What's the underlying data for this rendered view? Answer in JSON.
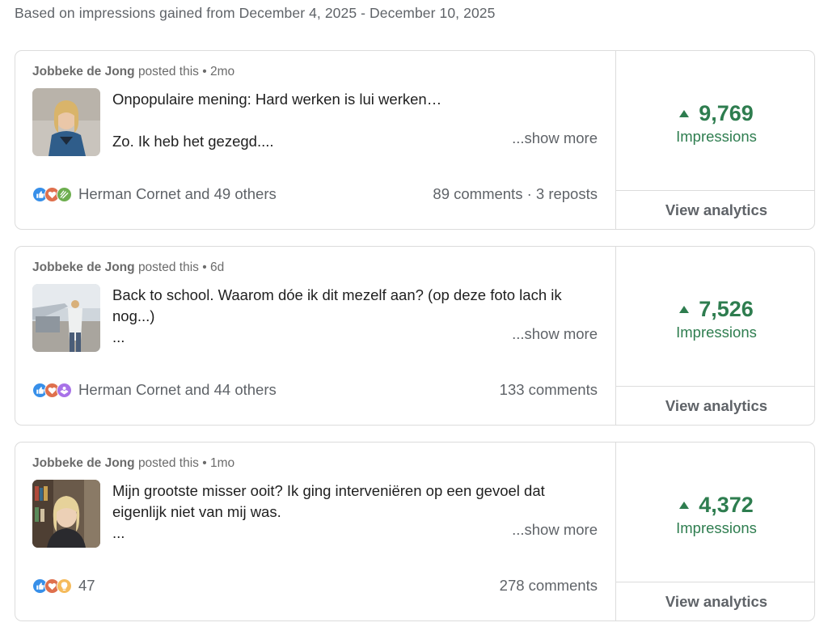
{
  "header": {
    "text": "Based on impressions gained from December 4, 2025 - December 10, 2025"
  },
  "posts": [
    {
      "author": "Jobbeke de Jong",
      "posted_label": "posted this",
      "age": "2mo",
      "text": "Onpopulaire mening: Hard werken is lui werken…\n\nZo. Ik heb het gezegd....",
      "show_more": "...show more",
      "reaction_icons": [
        "like-icon",
        "love-icon",
        "celebrate-icon"
      ],
      "reactors": "Herman Cornet and 49 others",
      "engagement": "89 comments · 3 reposts",
      "impressions_value": "9,769",
      "impressions_label": "Impressions",
      "view_analytics": "View analytics"
    },
    {
      "author": "Jobbeke de Jong",
      "posted_label": "posted this",
      "age": "6d",
      "text": "Back to school. Waarom dóe ik dit mezelf aan? (op deze foto lach ik nog...)\n...",
      "show_more": "...show more",
      "reaction_icons": [
        "like-icon",
        "love-icon",
        "support-icon"
      ],
      "reactors": "Herman Cornet and 44 others",
      "engagement": "133 comments",
      "impressions_value": "7,526",
      "impressions_label": "Impressions",
      "view_analytics": "View analytics"
    },
    {
      "author": "Jobbeke de Jong",
      "posted_label": "posted this",
      "age": "1mo",
      "text": "Mijn grootste misser ooit? Ik ging interveniëren op een gevoel dat eigenlijk niet van mij was.\n...",
      "show_more": "...show more",
      "reaction_icons": [
        "like-icon",
        "love-icon",
        "insightful-icon"
      ],
      "reactors": "47",
      "engagement": "278 comments",
      "impressions_value": "4,372",
      "impressions_label": "Impressions",
      "view_analytics": "View analytics"
    }
  ],
  "colors": {
    "accent_green": "#2e7d4f",
    "muted_text": "#5f6368",
    "border": "#dcdcdc",
    "like_blue": "#378fe9",
    "love_red": "#df704d",
    "celebrate_green": "#6dae4f",
    "insightful_yellow": "#f5bb5c",
    "support_purple": "#a872e8"
  }
}
